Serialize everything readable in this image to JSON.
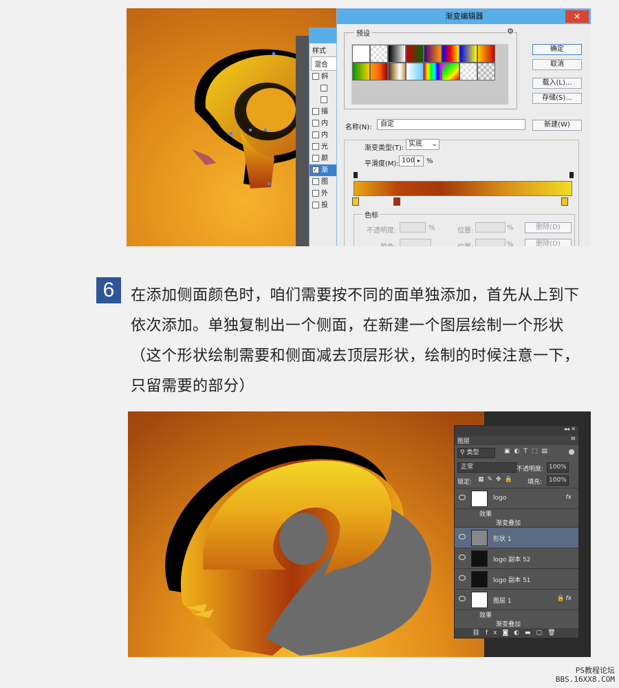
{
  "gradient_editor": {
    "title": "渐变编辑器",
    "preset_label": "预设",
    "ok": "确定",
    "cancel": "取消",
    "load": "载入(L)...",
    "save": "存储(S)...",
    "name_label": "名称(N):",
    "name_value": "自定",
    "new_button": "新建(W)",
    "type_label": "渐变类型(T):",
    "type_value": "实底",
    "smooth_label": "平滑度(M):",
    "smooth_value": "100",
    "smooth_unit": "%",
    "color_stop_group": "色标",
    "opacity_label": "不透明度:",
    "position_label": "位置:",
    "delete_label": "删除(D)",
    "color_label": "颜色:",
    "percent": "%"
  },
  "layer_style": {
    "header": "样式",
    "blend": "混合",
    "items": [
      "斜",
      "",
      "",
      "描",
      "内",
      "内",
      "光",
      "颜",
      "渐",
      "图",
      "外",
      "投"
    ]
  },
  "step": {
    "number": "6",
    "text": "在添加侧面颜色时，咱们需要按不同的面单独添加，首先从上到下依次添加。单独复制出一个侧面，在新建一个图层绘制一个形状（这个形状绘制需要和侧面减去顶层形状，绘制的时候注意一下，只留需要的部分）",
    "badge_color": "#2f5597"
  },
  "layers_panel": {
    "title": "图层",
    "filter_label": "类型",
    "blend_mode": "正常",
    "opacity_label": "不透明度:",
    "opacity_value": "100%",
    "lock_label": "锁定:",
    "fill_label": "填充:",
    "fill_value": "100%",
    "layers": [
      {
        "name": "logo",
        "fx": "fx",
        "effects_label": "效果",
        "effect": "渐变叠加"
      },
      {
        "name": "形状 1"
      },
      {
        "name": "logo 副本 52"
      },
      {
        "name": "logo 副本 51"
      },
      {
        "name": "图层 1",
        "fx": "fx",
        "effects_label": "效果",
        "effect": "渐变叠加"
      }
    ],
    "bottom_icons": [
      "link-icon",
      "fx-icon",
      "mask-icon",
      "adjustment-icon",
      "folder-icon",
      "new-layer-icon",
      "trash-icon"
    ]
  },
  "watermark": {
    "line1": "PS教程论坛",
    "line2": "BBS.16XX8.COM"
  }
}
